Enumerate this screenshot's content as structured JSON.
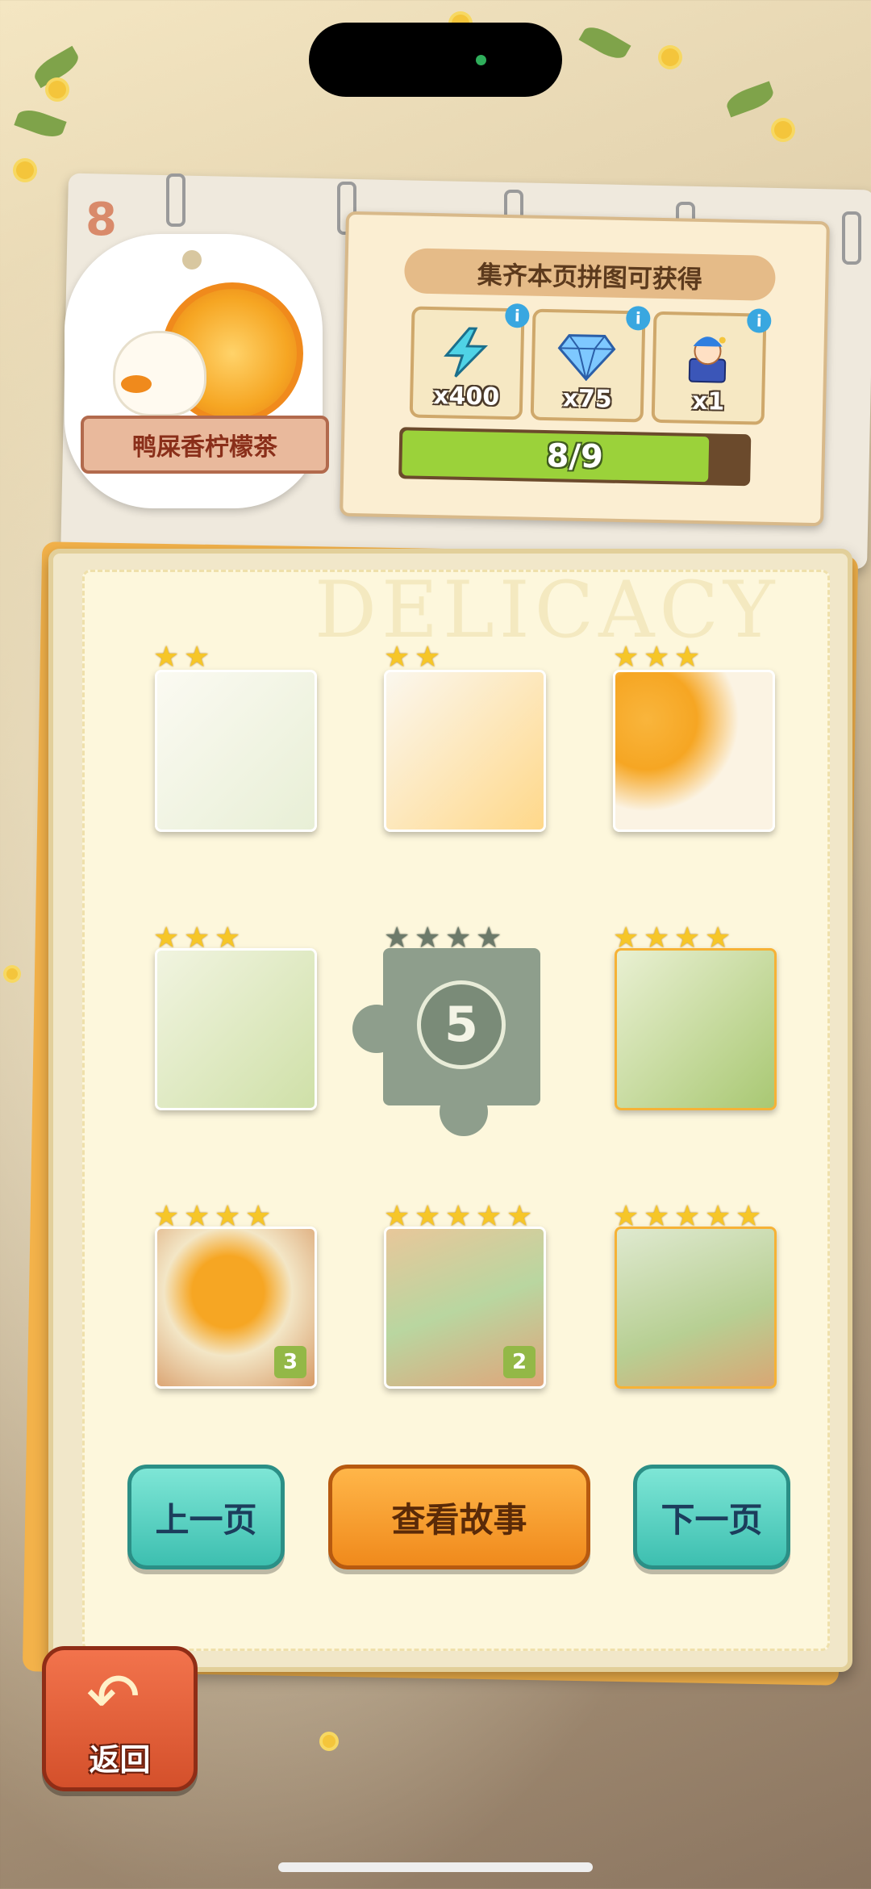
{
  "page": {
    "number": "8"
  },
  "tag": {
    "title": "鸭屎香柠檬茶"
  },
  "reward_panel": {
    "title": "集齐本页拼图可获得",
    "items": [
      {
        "icon": "lightning-energy-icon",
        "count": "x400"
      },
      {
        "icon": "blue-diamond-icon",
        "count": "x75"
      },
      {
        "icon": "jester-character-icon",
        "count": "x1"
      }
    ],
    "info_label": "i",
    "progress_text": "8/9",
    "progress_value": 0.889
  },
  "watermark": "DELICACY",
  "pieces": [
    {
      "stars": 2,
      "badge": ""
    },
    {
      "stars": 2,
      "badge": ""
    },
    {
      "stars": 3,
      "badge": ""
    },
    {
      "stars": 3,
      "badge": ""
    },
    {
      "stars": 4,
      "locked": true,
      "lock_number": "5"
    },
    {
      "stars": 4,
      "badge": ""
    },
    {
      "stars": 4,
      "badge": "3"
    },
    {
      "stars": 5,
      "badge": "2"
    },
    {
      "stars": 5,
      "badge": ""
    }
  ],
  "buttons": {
    "prev": "上一页",
    "story": "查看故事",
    "next": "下一页",
    "back": "返回"
  },
  "colors": {
    "accent_orange": "#f08a1c",
    "teal": "#3dbfb0",
    "progress_green": "#9bd23a"
  }
}
